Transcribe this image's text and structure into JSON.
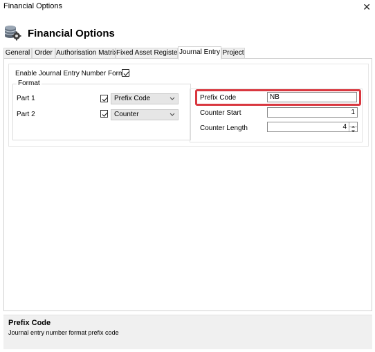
{
  "window": {
    "title": "Financial Options",
    "close_glyph": "✕"
  },
  "header": {
    "title": "Financial Options",
    "icon": "database-gear-icon"
  },
  "tabs": [
    {
      "label": "General",
      "active": false
    },
    {
      "label": "Order",
      "active": false
    },
    {
      "label": "Authorisation Matrix",
      "active": false
    },
    {
      "label": "Fixed Asset Register",
      "active": false
    },
    {
      "label": "Journal Entry",
      "active": true
    },
    {
      "label": "Project",
      "active": false
    }
  ],
  "journal_entry": {
    "enable_label": "Enable Journal Entry Number Format",
    "enable_checked": true,
    "format_group_label": "Format",
    "part1": {
      "label": "Part 1",
      "checked": true,
      "selected": "Prefix Code"
    },
    "part2": {
      "label": "Part 2",
      "checked": true,
      "selected": "Counter"
    },
    "prefix_code": {
      "label": "Prefix Code",
      "value": "NB"
    },
    "counter_start": {
      "label": "Counter Start",
      "value": "1"
    },
    "counter_length": {
      "label": "Counter Length",
      "value": "4"
    }
  },
  "help": {
    "title": "Prefix Code",
    "text": "Journal entry number format prefix code"
  },
  "colors": {
    "highlight": "#d9373f",
    "combo_bg": "#e6e6e6",
    "help_bg": "#f0f0f0"
  }
}
